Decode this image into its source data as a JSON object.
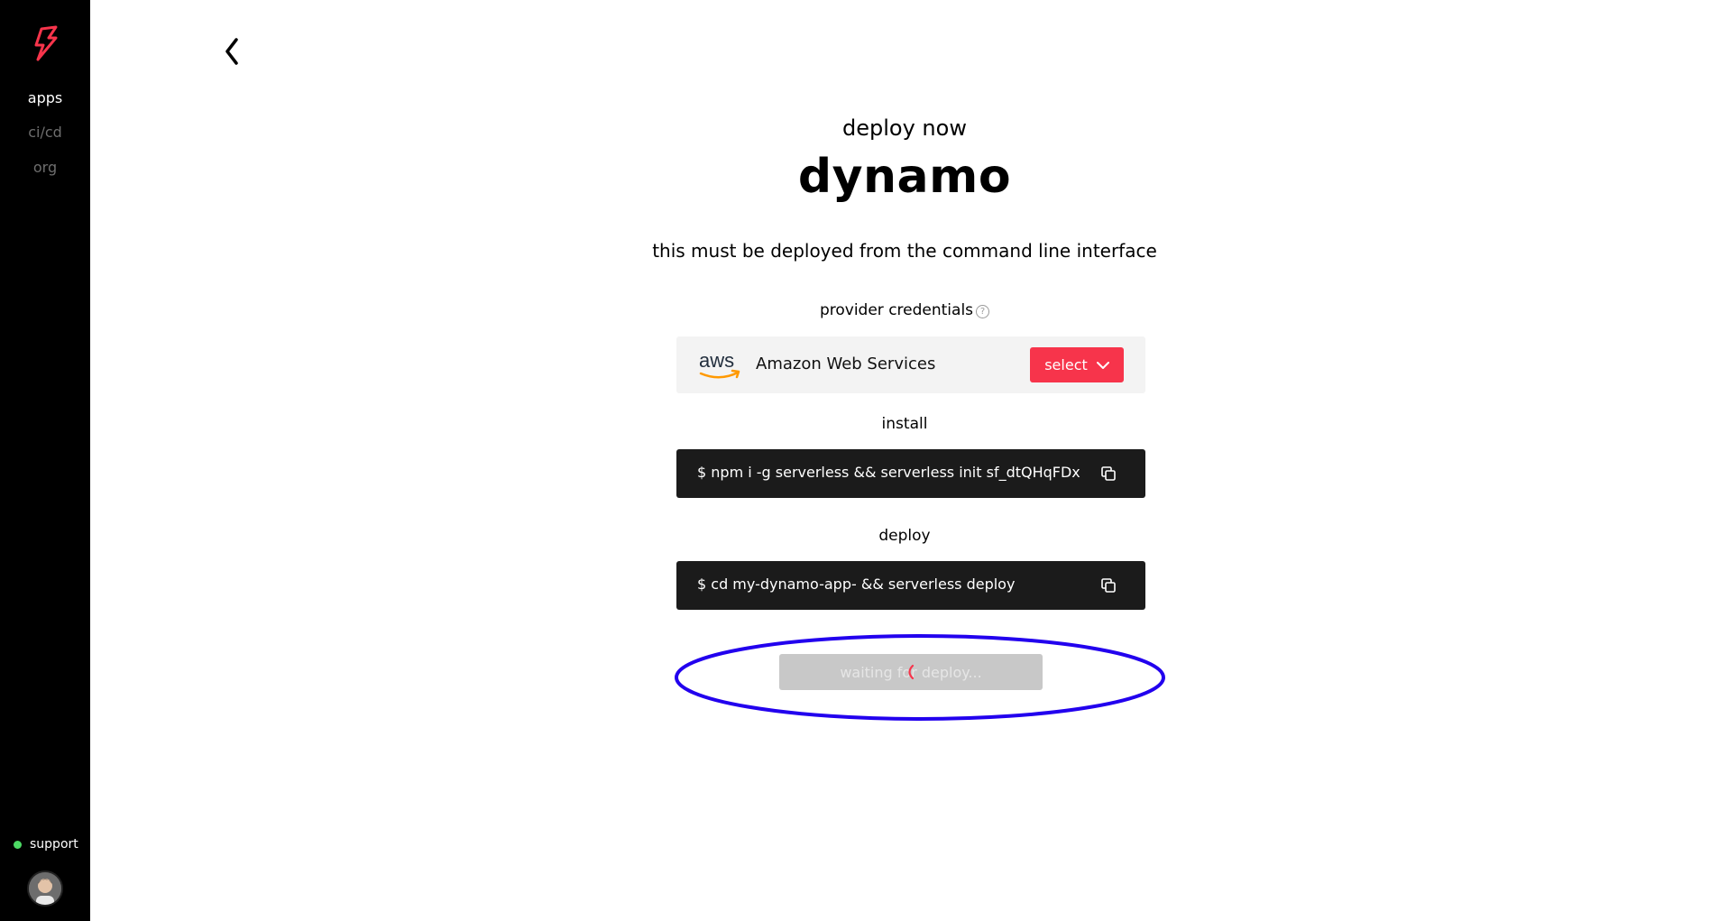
{
  "sidebar": {
    "nav": [
      {
        "label": "apps",
        "active": true
      },
      {
        "label": "ci/cd",
        "active": false
      },
      {
        "label": "org",
        "active": false
      }
    ],
    "support_label": "support",
    "status_color": "#4cd964",
    "logo_color": "#f7344b"
  },
  "header": {
    "back_icon": "chevron-left-icon"
  },
  "main": {
    "subtitle": "deploy now",
    "title": "dynamo",
    "description": "this must be deployed from the command line interface",
    "provider_label": "provider credentials",
    "help_icon_glyph": "?",
    "provider_logo_text": "aws",
    "provider_name": "Amazon Web Services",
    "select_label": "select",
    "install_label": "install",
    "install_command": "$  npm i -g serverless && serverless init sf_dtQHqFDx",
    "deploy_label": "deploy",
    "deploy_command": "$  cd my-dynamo-app- && serverless deploy",
    "wait_label": "waiting for deploy...",
    "accent_color": "#f7344b",
    "annotation_color": "#2200ee"
  }
}
